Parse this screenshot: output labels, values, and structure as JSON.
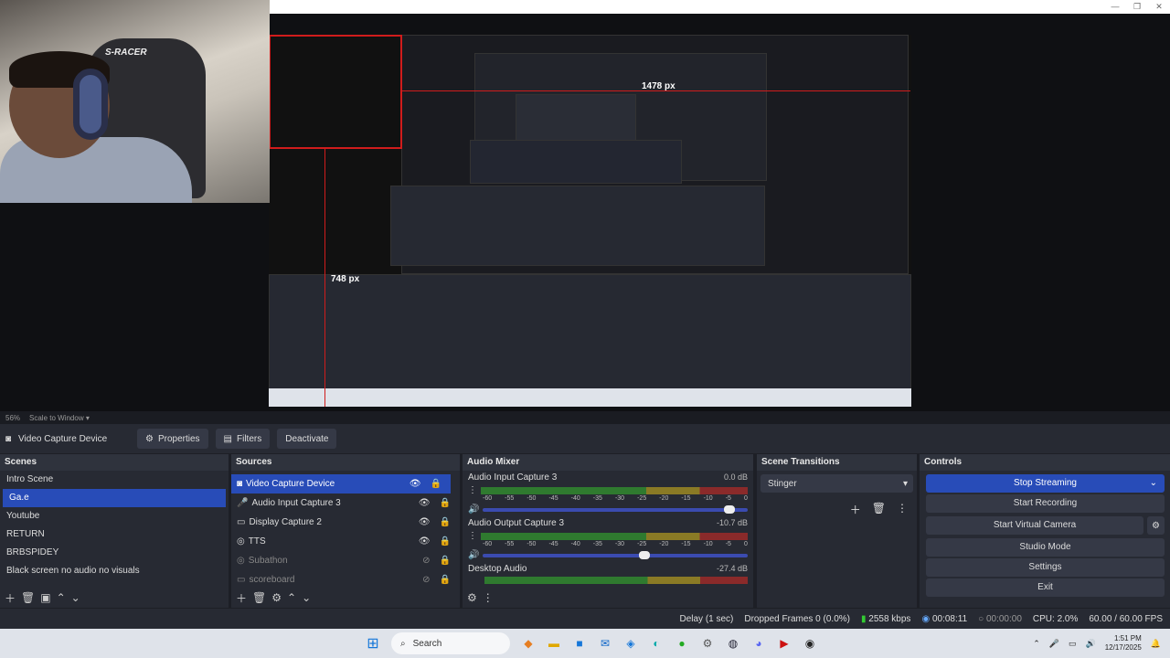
{
  "preview": {
    "measure_h": "1478 px",
    "measure_v": "748 px",
    "webcam_logo": "S-RACER",
    "scale_pct": "56%",
    "scale_mode": "Scale to Window"
  },
  "propbar": {
    "source_name": "Video Capture Device",
    "properties": "Properties",
    "filters": "Filters",
    "deactivate": "Deactivate"
  },
  "scenes": {
    "header": "Scenes",
    "items": [
      "Intro Scene",
      "Ga.e",
      "Youtube",
      "RETURN",
      "BRBSPIDEY",
      "Black screen no audio no visuals"
    ]
  },
  "sources": {
    "header": "Sources",
    "items": [
      "Video Capture Device",
      "Audio Input Capture 3",
      "Display Capture 2",
      "TTS",
      "Subathon",
      "scoreboard"
    ]
  },
  "mixer": {
    "header": "Audio Mixer",
    "channels": [
      {
        "name": "Audio Input Capture 3",
        "db": "0.0 dB",
        "level": 0.93
      },
      {
        "name": "Audio Output Capture 3",
        "db": "-10.7 dB",
        "level": 0.61
      },
      {
        "name": "Desktop Audio",
        "db": "-27.4 dB",
        "level": 0.0
      }
    ],
    "ticks": [
      "-60",
      "-55",
      "-50",
      "-45",
      "-40",
      "-35",
      "-30",
      "-25",
      "-20",
      "-15",
      "-10",
      "-5",
      "0"
    ]
  },
  "transitions": {
    "header": "Scene Transitions",
    "selected": "Stinger"
  },
  "controls": {
    "header": "Controls",
    "stop_streaming": "Stop Streaming",
    "start_recording": "Start Recording",
    "start_virtual_camera": "Start Virtual Camera",
    "studio_mode": "Studio Mode",
    "settings": "Settings",
    "exit": "Exit"
  },
  "status": {
    "delay": "Delay (1 sec)",
    "dropped": "Dropped Frames 0 (0.0%)",
    "bitrate": "2558 kbps",
    "stream_time": "00:08:11",
    "rec_time": "00:00:00",
    "cpu": "CPU: 2.0%",
    "fps": "60.00 / 60.00 FPS"
  },
  "taskbar": {
    "search": "Search",
    "time": "1:51 PM",
    "date": "12/17/2025"
  }
}
